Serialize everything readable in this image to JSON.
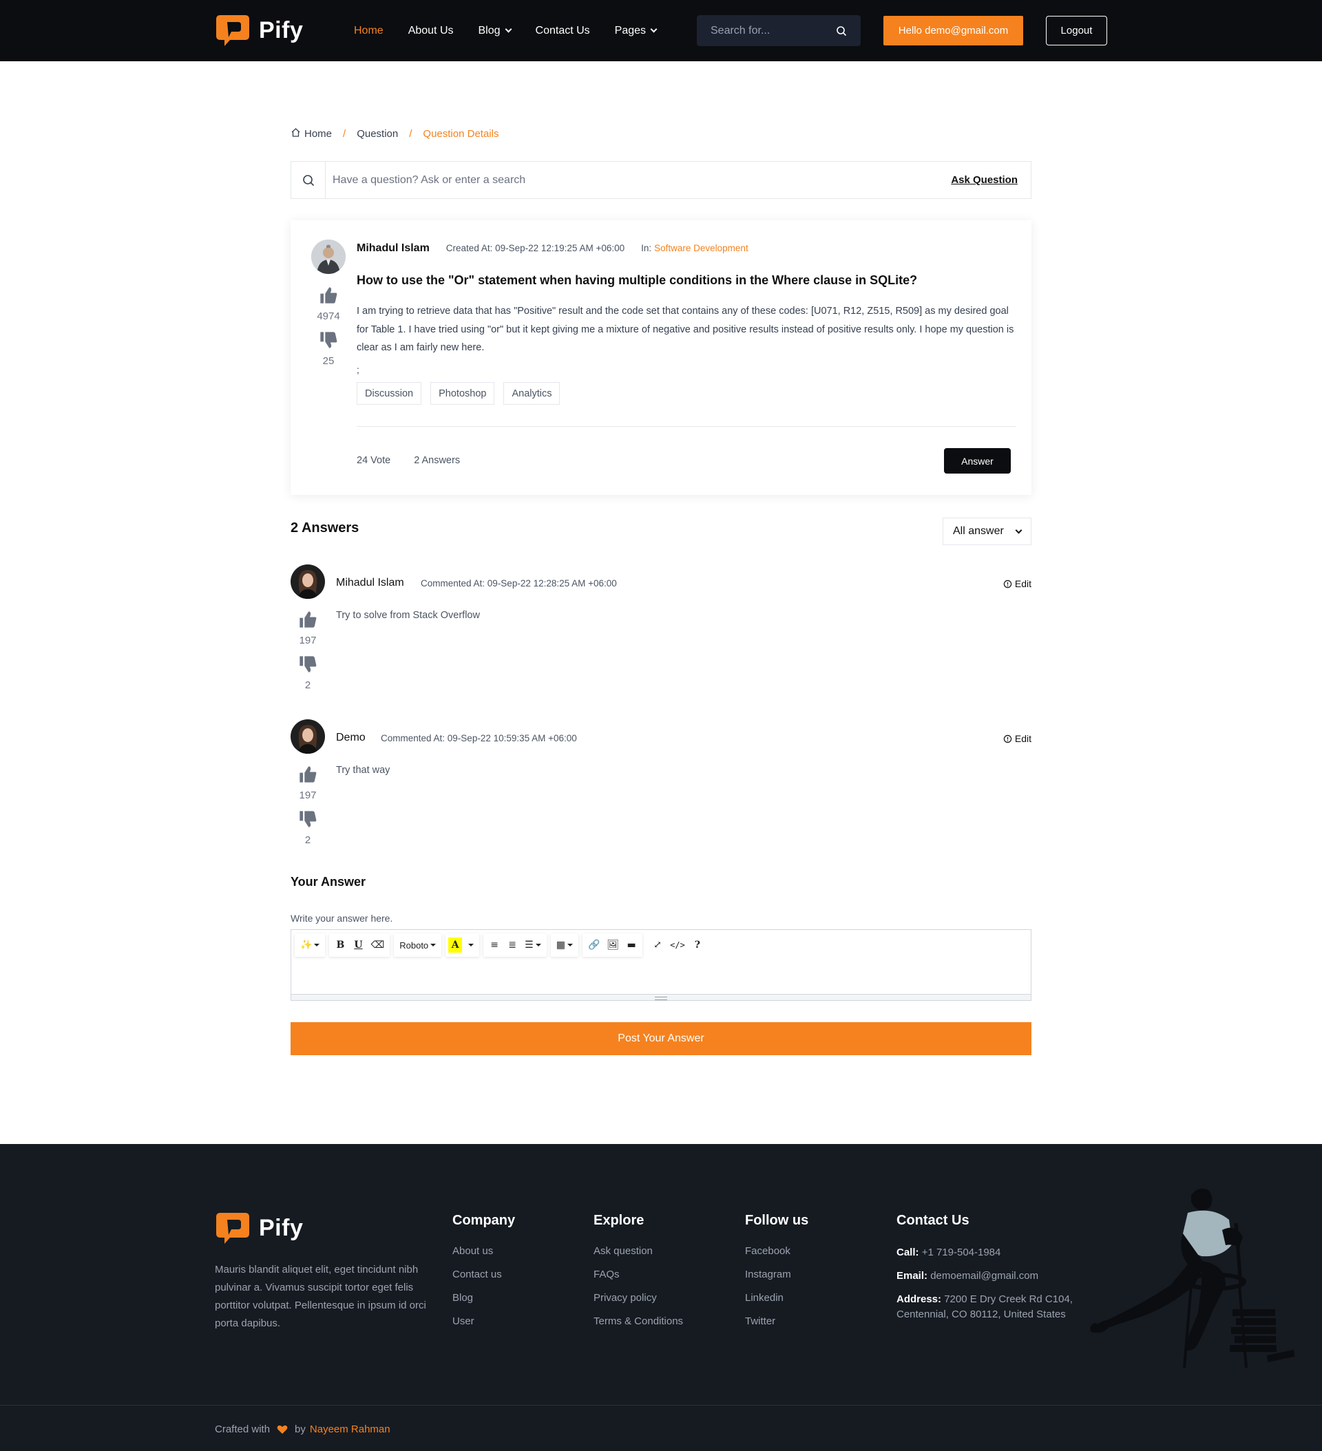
{
  "brand": {
    "name": "Pify",
    "accent": "#f5821f",
    "dark": "#0b0d10"
  },
  "nav": {
    "items": [
      {
        "label": "Home",
        "active": true,
        "dropdown": false
      },
      {
        "label": "About Us",
        "active": false,
        "dropdown": false
      },
      {
        "label": "Blog",
        "active": false,
        "dropdown": true
      },
      {
        "label": "Contact Us",
        "active": false,
        "dropdown": false
      },
      {
        "label": "Pages",
        "active": false,
        "dropdown": true
      }
    ],
    "search_placeholder": "Search for...",
    "hello_label": "Hello demo@gmail.com",
    "logout_label": "Logout"
  },
  "breadcrumb": {
    "home": "Home",
    "question": "Question",
    "current": "Question Details"
  },
  "qsearch": {
    "placeholder": "Have a question? Ask or enter a search",
    "ask_label": "Ask Question"
  },
  "question": {
    "author": "Mihadul Islam",
    "created": "Created At: 09-Sep-22 12:19:25 AM +06:00",
    "in_label": "In:",
    "category": "Software Development",
    "upvotes": "4974",
    "downvotes": "25",
    "title": "How to use the \"Or\" statement when having multiple conditions in the Where clause in SQLite?",
    "body": "I am trying to retrieve data that has \"Positive\" result and the code set that contains any of these codes: [U071, R12, Z515, R509] as my desired goal for Table 1. I have tried using \"or\" but it kept giving me a mixture of negative and positive results instead of positive results only. I hope my question is clear as I am fairly new here.",
    "trailing": ";",
    "tags": [
      "Discussion",
      "Photoshop",
      "Analytics"
    ],
    "votes_label": "24 Vote",
    "answers_label": "2 Answers",
    "answer_button": "Answer"
  },
  "answers_section": {
    "title": "2 Answers",
    "filter": "All answer",
    "items": [
      {
        "author": "Mihadul Islam",
        "meta": "Commented At: 09-Sep-22 12:28:25 AM +06:00",
        "text": "Try to solve from Stack Overflow",
        "upvotes": "197",
        "downvotes": "2",
        "edit": "Edit"
      },
      {
        "author": "Demo",
        "meta": "Commented At: 09-Sep-22 10:59:35 AM +06:00",
        "text": "Try that way",
        "upvotes": "197",
        "downvotes": "2",
        "edit": "Edit"
      }
    ]
  },
  "your_answer": {
    "title": "Your Answer",
    "label": "Write your answer here.",
    "font_select": "Roboto",
    "post_button": "Post Your Answer"
  },
  "footer": {
    "description": "Mauris blandit aliquet elit, eget tincidunt nibh pulvinar a. Vivamus suscipit tortor eget felis porttitor volutpat. Pellentesque in ipsum id orci porta dapibus.",
    "company": {
      "title": "Company",
      "links": [
        "About us",
        "Contact us",
        "Blog",
        "User"
      ]
    },
    "explore": {
      "title": "Explore",
      "links": [
        "Ask question",
        "FAQs",
        "Privacy policy",
        "Terms & Conditions"
      ]
    },
    "follow": {
      "title": "Follow us",
      "links": [
        "Facebook",
        "Instagram",
        "Linkedin",
        "Twitter"
      ]
    },
    "contact": {
      "title": "Contact Us",
      "call_label": "Call:",
      "call": "+1 719-504-1984",
      "email_label": "Email:",
      "email": "demoemail@gmail.com",
      "address_label": "Address:",
      "address": "7200 E Dry Creek Rd C104, Centennial, CO 80112, United States"
    },
    "crafted": "Crafted with",
    "by": "by",
    "author": "Nayeem Rahman"
  }
}
